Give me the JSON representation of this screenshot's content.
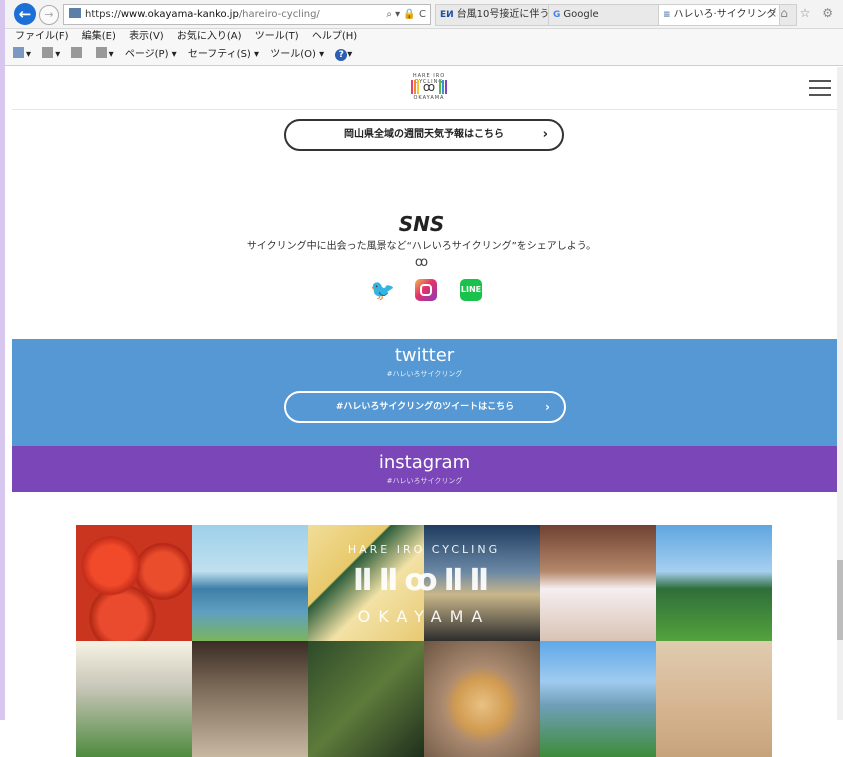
{
  "browser": {
    "url_scheme": "https://",
    "url_domain": "www.okayama-kanko.jp",
    "url_path": "/hareiro-cycling/",
    "url_actions": "⌕ ▾ 🔒 C",
    "tabs": [
      {
        "icon": "ЕИ",
        "label": "台風10号接近に伴う大..."
      },
      {
        "icon": "G",
        "label": "Google"
      },
      {
        "icon": "≡",
        "label": "ハレいろ·サイクリング ...",
        "close": "×"
      }
    ],
    "window_icons": "⌂ ☆ ⚙",
    "menu": [
      "ファイル(F)",
      "編集(E)",
      "表示(V)",
      "お気に入り(A)",
      "ツール(T)",
      "ヘルプ(H)"
    ],
    "commands": [
      "▾",
      "▾",
      "▾",
      "ページ(P) ▾",
      "セーフティ(S) ▾",
      "ツール(O) ▾",
      "▾"
    ]
  },
  "site": {
    "logo_top": "HARE IRO CYCLING",
    "logo_bottom": "OKAYAMA",
    "logo_colors": [
      "#e6407a",
      "#f08a2b",
      "#f3c93a",
      "#58b94f",
      "#3e8fd8",
      "#7a46b8"
    ],
    "weather_button": "岡山県全域の週間天気予報はこちら",
    "arrow": "›",
    "sns": {
      "title": "SNS",
      "description": "サイクリング中に出会った風景など“ハレいろサイクリング”をシェアしよう。",
      "bike_glyph": "ꝏ",
      "icons": {
        "twitter": "🐦",
        "line": "LINE"
      }
    },
    "twitter": {
      "title": "twitter",
      "hashtag": "#ハレいろサイクリング",
      "button": "#ハレいろサイクリングのツイートはこちら",
      "color": "#5598d4"
    },
    "instagram": {
      "title": "instagram",
      "hashtag": "#ハレいろサイクリング",
      "color": "#7a46b8"
    },
    "overlay": {
      "top": "HARE IRO CYCLING",
      "middle": "ⅡⅡꝏⅡⅡ",
      "bottom": "OKAYAMA"
    }
  }
}
